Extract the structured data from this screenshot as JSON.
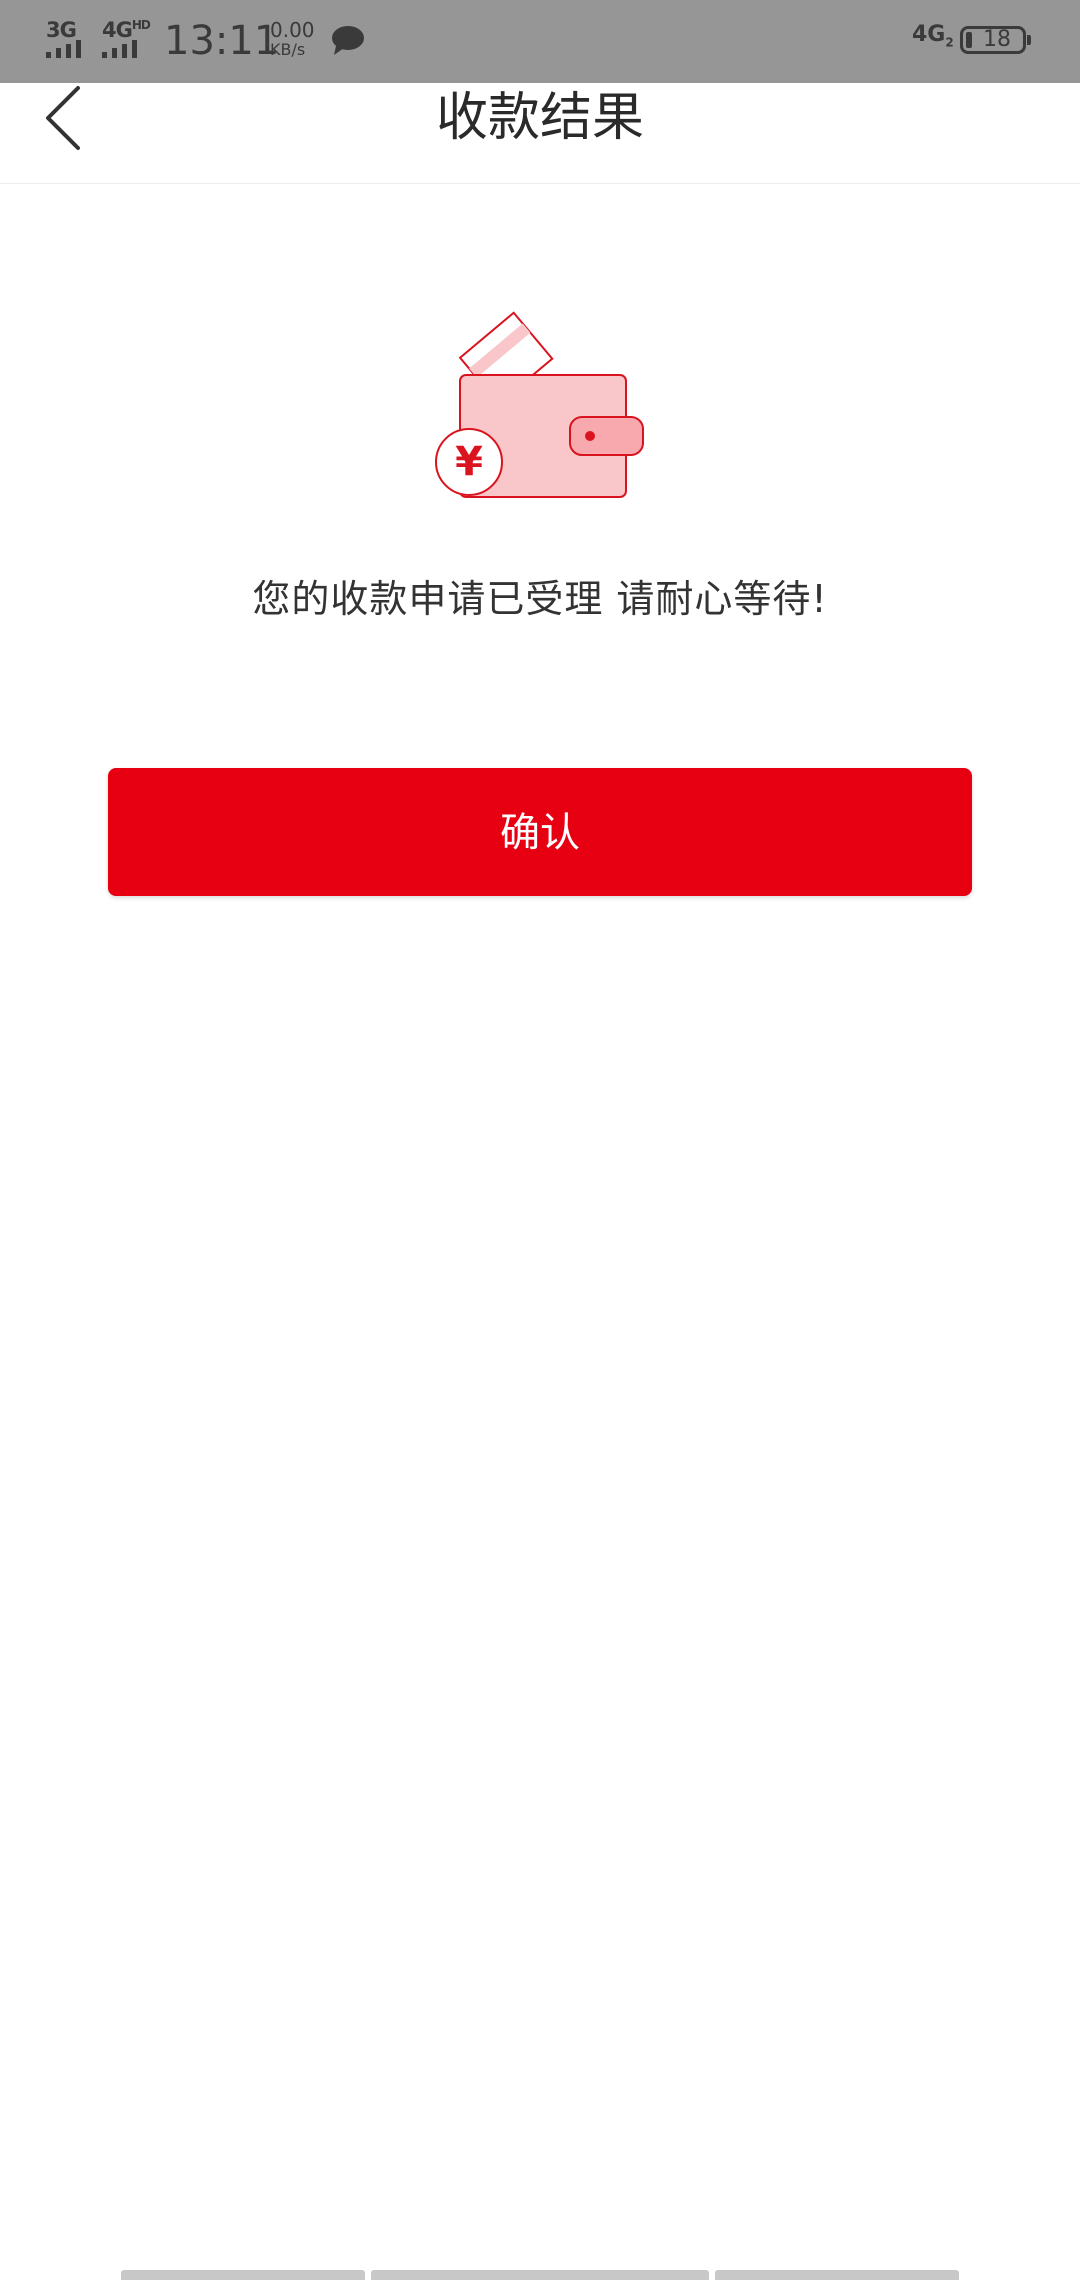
{
  "status_bar": {
    "network_1": "3G",
    "network_2": "4G",
    "network_2_badge": "HD",
    "time": "13:11",
    "speed_value": "0.00",
    "speed_unit": "KB/s",
    "right_network": "4G",
    "right_network_sub": "2",
    "battery": "18",
    "icons": [
      "signal-icon",
      "signal-icon",
      "chat-bubble-icon",
      "battery-icon"
    ]
  },
  "header": {
    "title": "收款结果",
    "back_icon": "chevron-left-icon"
  },
  "main": {
    "illustration_icon": "wallet-yuan-icon",
    "message": "您的收款申请已受理 请耐心等待!",
    "confirm_label": "确认"
  },
  "colors": {
    "accent": "#e60012",
    "status_bar_bg": "#969696",
    "illustration_fill": "#f9c7c9",
    "illustration_stroke": "#d9141f"
  }
}
